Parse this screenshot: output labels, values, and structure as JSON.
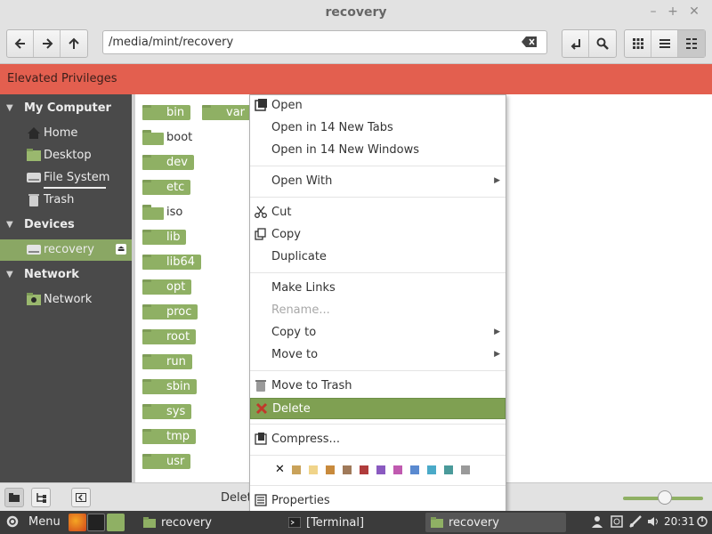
{
  "window": {
    "title": "recovery"
  },
  "toolbar": {
    "path": "/media/mint/recovery"
  },
  "banner": {
    "text": "Elevated Privileges"
  },
  "sidebar": {
    "sections": [
      {
        "label": "My Computer"
      },
      {
        "label": "Devices"
      },
      {
        "label": "Network"
      }
    ],
    "items": [
      {
        "label": "Home"
      },
      {
        "label": "Desktop"
      },
      {
        "label": "File System"
      },
      {
        "label": "Trash"
      },
      {
        "label": "recovery"
      },
      {
        "label": "Network"
      }
    ]
  },
  "files": [
    {
      "name": "bin",
      "type": "folder"
    },
    {
      "name": "var",
      "type": "folder"
    },
    {
      "name": "boot",
      "type": "plain"
    },
    {
      "name": "dev",
      "type": "folder"
    },
    {
      "name": "etc",
      "type": "folder"
    },
    {
      "name": "iso",
      "type": "plain"
    },
    {
      "name": "lib",
      "type": "folder"
    },
    {
      "name": "lib64",
      "type": "folder"
    },
    {
      "name": "opt",
      "type": "folder"
    },
    {
      "name": "proc",
      "type": "folder"
    },
    {
      "name": "root",
      "type": "folder"
    },
    {
      "name": "run",
      "type": "folder"
    },
    {
      "name": "sbin",
      "type": "folder"
    },
    {
      "name": "sys",
      "type": "folder"
    },
    {
      "name": "tmp",
      "type": "folder"
    },
    {
      "name": "usr",
      "type": "folder"
    }
  ],
  "context_menu": {
    "open": "Open",
    "open_tabs": "Open in 14 New Tabs",
    "open_windows": "Open in 14 New Windows",
    "open_with": "Open With",
    "cut": "Cut",
    "copy": "Copy",
    "duplicate": "Duplicate",
    "make_links": "Make Links",
    "rename": "Rename...",
    "copy_to": "Copy to",
    "move_to": "Move to",
    "move_to_trash": "Move to Trash",
    "delete": "Delete",
    "compress": "Compress...",
    "properties": "Properties",
    "swatch_colors": [
      "#c9a25a",
      "#f0d48a",
      "#c88a3c",
      "#a07a5a",
      "#b03c3c",
      "#8a5ac0",
      "#c05ab0",
      "#5a8ad0",
      "#4aaac8",
      "#4a9a9a",
      "#9a9a9a"
    ]
  },
  "statusbar": {
    "text": "Delete"
  },
  "taskbar": {
    "menu_label": "Menu",
    "windows": [
      {
        "label": "recovery"
      },
      {
        "label": "[Terminal]"
      },
      {
        "label": "recovery"
      }
    ],
    "clock": "20:31"
  },
  "colors": {
    "accent": "#8fb064",
    "banner": "#e35f4f",
    "sidebar_bg": "#4a4a4a",
    "taskbar_bg": "#3b3b3b"
  }
}
